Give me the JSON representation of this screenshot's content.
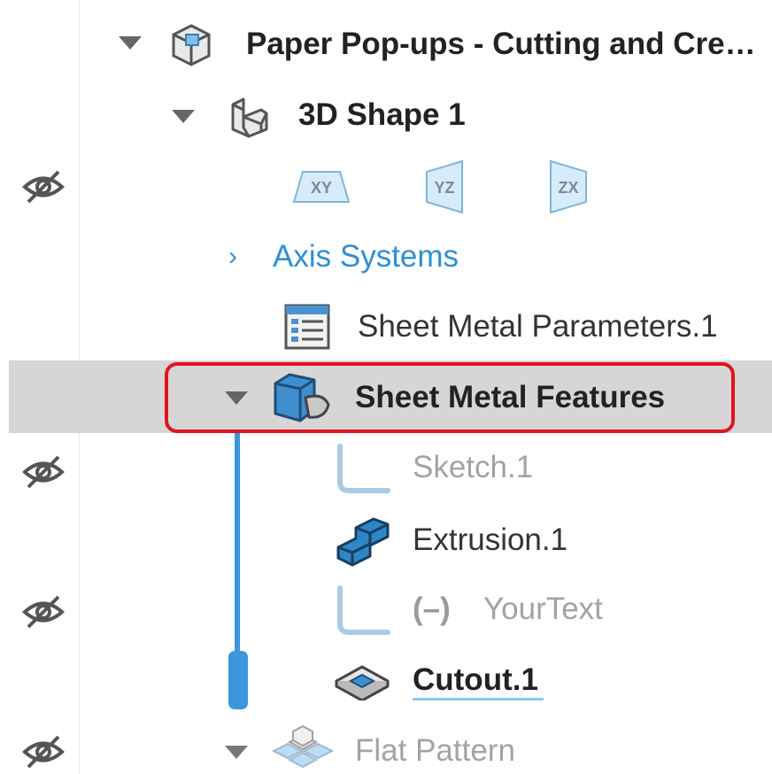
{
  "tree": {
    "root": {
      "label": "Paper Pop-ups - Cutting and Cre…",
      "icon": "product-icon"
    },
    "shape": {
      "label": "3D Shape 1",
      "icon": "3d-shape-icon"
    },
    "planes": [
      {
        "label": "XY",
        "icon": "xy-plane-icon"
      },
      {
        "label": "YZ",
        "icon": "yz-plane-icon"
      },
      {
        "label": "ZX",
        "icon": "zx-plane-icon"
      }
    ],
    "axis_systems": {
      "label": "Axis Systems",
      "chevron": "›"
    },
    "sheet_metal_params": {
      "label": "Sheet Metal Parameters.1",
      "icon": "parameters-table-icon"
    },
    "sheet_metal_features": {
      "label": "Sheet Metal Features",
      "icon": "sheet-metal-features-icon"
    },
    "children": [
      {
        "label": "Sketch.1",
        "icon": "sketch-icon",
        "state": "hidden"
      },
      {
        "label": "Extrusion.1",
        "icon": "extrusion-icon",
        "state": "normal"
      },
      {
        "prefix": "(–)",
        "label": "YourText",
        "icon": "sketch-icon",
        "state": "hidden"
      },
      {
        "label": "Cutout.1",
        "icon": "cutout-icon",
        "state": "current"
      }
    ],
    "flat_pattern": {
      "label": "Flat Pattern",
      "icon": "flat-pattern-icon"
    }
  },
  "colors": {
    "selection_border": "#e0141e",
    "branch_line": "#3a96dd",
    "link_blue": "#2f8fd6"
  }
}
